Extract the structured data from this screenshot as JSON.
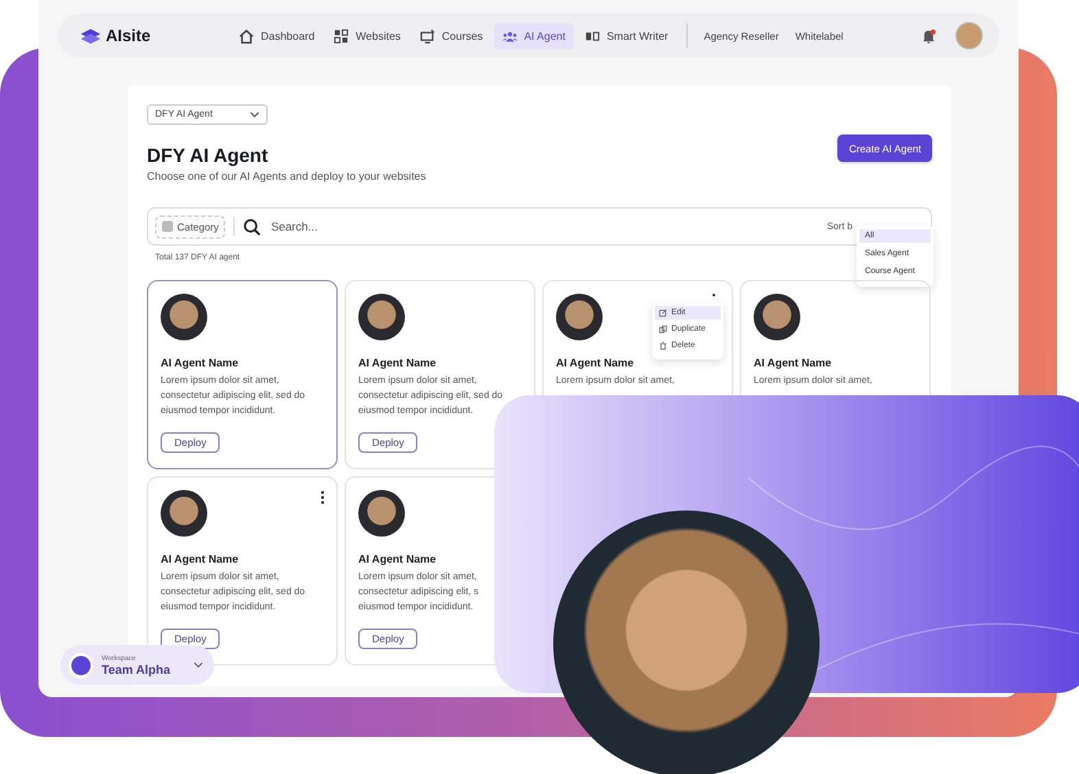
{
  "brand": {
    "name": "AIsite"
  },
  "nav": {
    "items": [
      {
        "label": "Dashboard",
        "selected": false
      },
      {
        "label": "Websites",
        "selected": false
      },
      {
        "label": "Courses",
        "selected": false
      },
      {
        "label": "AI Agent",
        "selected": true
      },
      {
        "label": "Smart Writer",
        "selected": false
      }
    ],
    "links": [
      "Agency Reseller",
      "Whitelabel"
    ],
    "notification": {
      "unread": true
    }
  },
  "page": {
    "view_select": "DFY AI Agent",
    "title": "DFY AI Agent",
    "subtitle": "Choose one of our AI Agents and deploy to your websites",
    "create_button": "Create AI Agent"
  },
  "filter": {
    "category": "Category",
    "search_placeholder": "Search...",
    "sort_label": "Sort b",
    "sort_options": [
      {
        "label": "All",
        "selected": true
      },
      {
        "label": "Sales Agent",
        "selected": false
      },
      {
        "label": "Course Agent",
        "selected": false
      }
    ]
  },
  "total": "Total 137 DFY AI agent",
  "cards": [
    {
      "name": "AI Agent Name",
      "lines": [
        "Lorem ipsum dolor sit amet,",
        "consectetur adipiscing elit, sed do",
        "eiusmod tempor incididunt."
      ],
      "deploy": "Deploy",
      "selected": true,
      "kind": "plain"
    },
    {
      "name": "AI Agent Name",
      "lines": [
        "Lorem ipsum dolor sit amet,",
        "consectetur adipiscing elit, sed do",
        "eiusmod tempor incididunt."
      ],
      "deploy": "Deploy",
      "selected": false,
      "kind": "plain"
    },
    {
      "name": "AI Agent Name",
      "lines": [
        "Lorem ipsum dolor sit amet,"
      ],
      "selected": false,
      "kind": "menu",
      "menu_items": [
        {
          "label": "Edit",
          "selected": true
        },
        {
          "label": "Duplicate",
          "selected": false
        },
        {
          "label": "Delete",
          "selected": false
        }
      ]
    },
    {
      "name": "AI Agent Name",
      "lines": [
        "Lorem ipsum dolor sit amet,"
      ],
      "selected": false,
      "kind": "plain"
    },
    {
      "name": "AI Agent Name",
      "lines": [
        "Lorem ipsum dolor sit amet,",
        "consectetur adipiscing elit, sed do",
        "eiusmod tempor incididunt."
      ],
      "deploy": "Deploy",
      "selected": false,
      "kind": "kebab"
    },
    {
      "name": "AI Agent Name",
      "lines": [
        "Lorem ipsum dolor sit amet,",
        "consectetur adipiscing elit, s",
        "eiusmod tempor incididunt."
      ],
      "deploy": "Deploy",
      "selected": false,
      "kind": "plain"
    }
  ],
  "workspace": {
    "caption": "Workspace",
    "name": "Team Alpha"
  }
}
